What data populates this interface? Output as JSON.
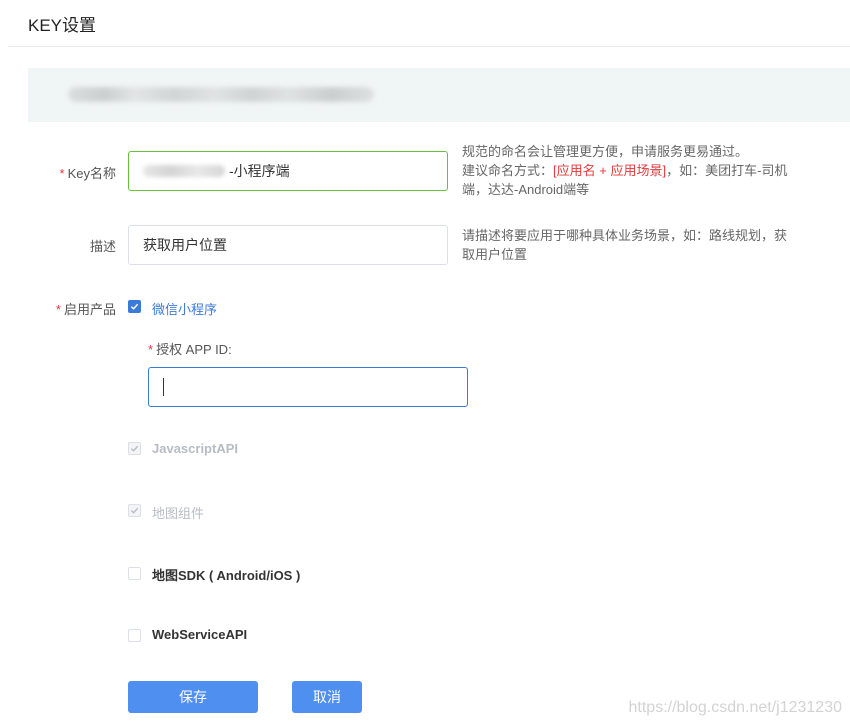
{
  "page": {
    "title": "KEY设置"
  },
  "key_name": {
    "required_mark": "*",
    "label": "Key名称",
    "value_suffix": "-小程序端",
    "hint_line1": "规范的命名会让管理更方便，申请服务更易通过。",
    "hint_prefix": "建议命名方式：",
    "hint_pattern": "[应用名 + 应用场景]",
    "hint_example_a": "，如：美团打车-司机",
    "hint_example_b": "端，达达-Android端等"
  },
  "description": {
    "label": "描述",
    "value": "获取用户位置",
    "hint_line1": "请描述将要应用于哪种具体业务场景，如：路线规划，获",
    "hint_line2": "取用户位置"
  },
  "products": {
    "required_mark": "*",
    "label": "启用产品",
    "items": [
      {
        "label": "微信小程序",
        "checked": true,
        "disabled": false
      },
      {
        "label": "JavascriptAPI",
        "checked": true,
        "disabled": true
      },
      {
        "label": "地图组件",
        "checked": true,
        "disabled": true
      },
      {
        "label": "地图SDK ( Android/iOS )",
        "checked": false,
        "disabled": false
      },
      {
        "label": "WebServiceAPI",
        "checked": false,
        "disabled": false
      }
    ],
    "appid": {
      "required_mark": "*",
      "label": "授权 APP ID:",
      "value": ""
    }
  },
  "actions": {
    "save_label": "保存",
    "cancel_label": "取消"
  },
  "watermark": "https://blog.csdn.net/j1231230",
  "colors": {
    "primary": "#4e8ff0",
    "required": "#e4393c",
    "valid_border": "#67c23a",
    "banner_bg": "#f0f5f5"
  }
}
